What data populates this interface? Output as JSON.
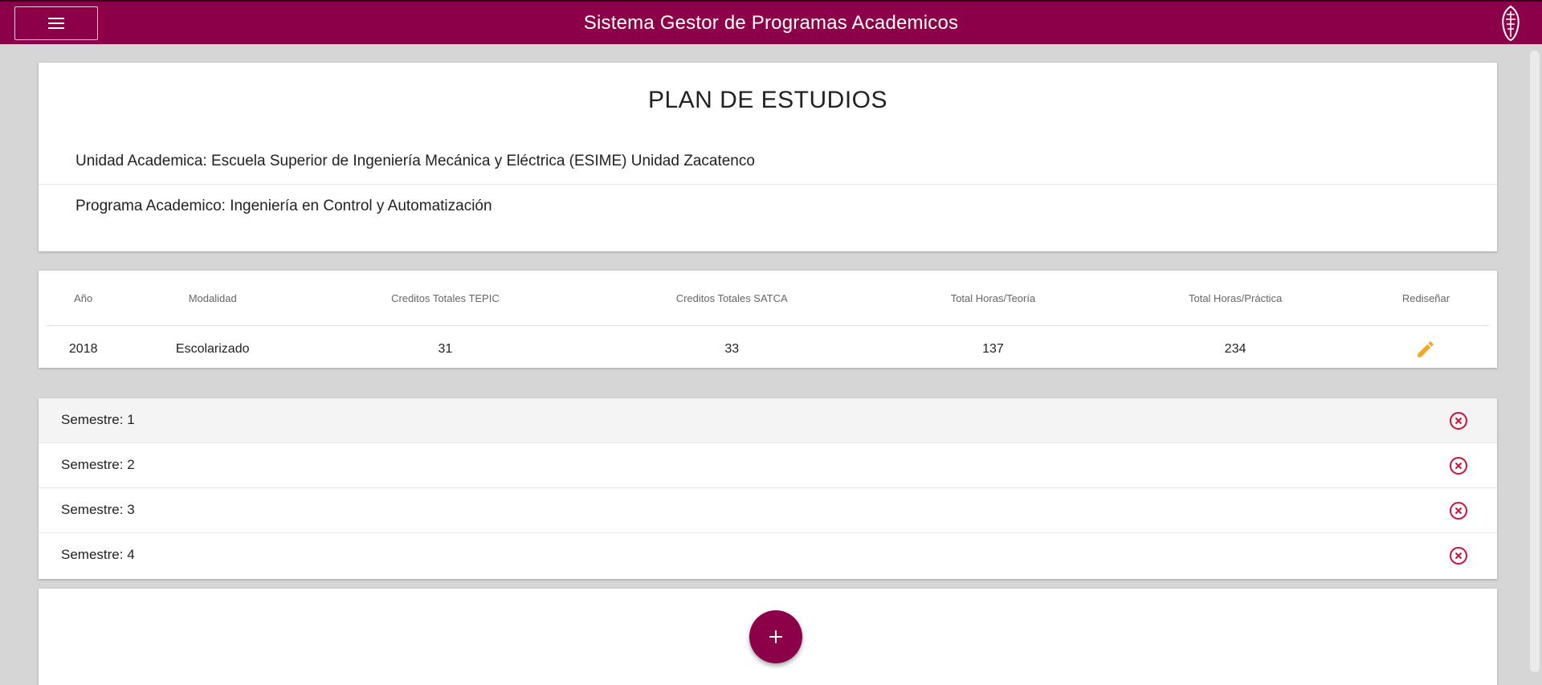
{
  "header": {
    "title": "Sistema Gestor de Programas Academicos",
    "menu_icon": "menu-icon",
    "logo_icon": "institution-logo",
    "brand_color": "#8b0049"
  },
  "plan": {
    "title": "PLAN DE ESTUDIOS",
    "unidad": "Unidad Academica: Escuela Superior de Ingeniería Mecánica y Eléctrica (ESIME) Unidad Zacatenco",
    "programa": "Programa Academico: Ingeniería en Control y Automatización"
  },
  "summary": {
    "columns": [
      "Año",
      "Modalidad",
      "Creditos Totales TEPIC",
      "Creditos Totales SATCA",
      "Total Horas/Teoría",
      "Total Horas/Práctica",
      "Rediseñar"
    ],
    "row": [
      "2018",
      "Escolarizado",
      "31",
      "33",
      "137",
      "234"
    ],
    "edit_icon": "pencil-icon",
    "edit_color": "#f5a623"
  },
  "semestres": [
    {
      "label": "Semestre: 1",
      "active": true
    },
    {
      "label": "Semestre: 2",
      "active": false
    },
    {
      "label": "Semestre: 3",
      "active": false
    },
    {
      "label": "Semestre: 4",
      "active": false
    }
  ],
  "semestre_delete_icon": "close-circle-icon",
  "delete_color": "#d0103a",
  "add_button_icon": "plus-icon"
}
